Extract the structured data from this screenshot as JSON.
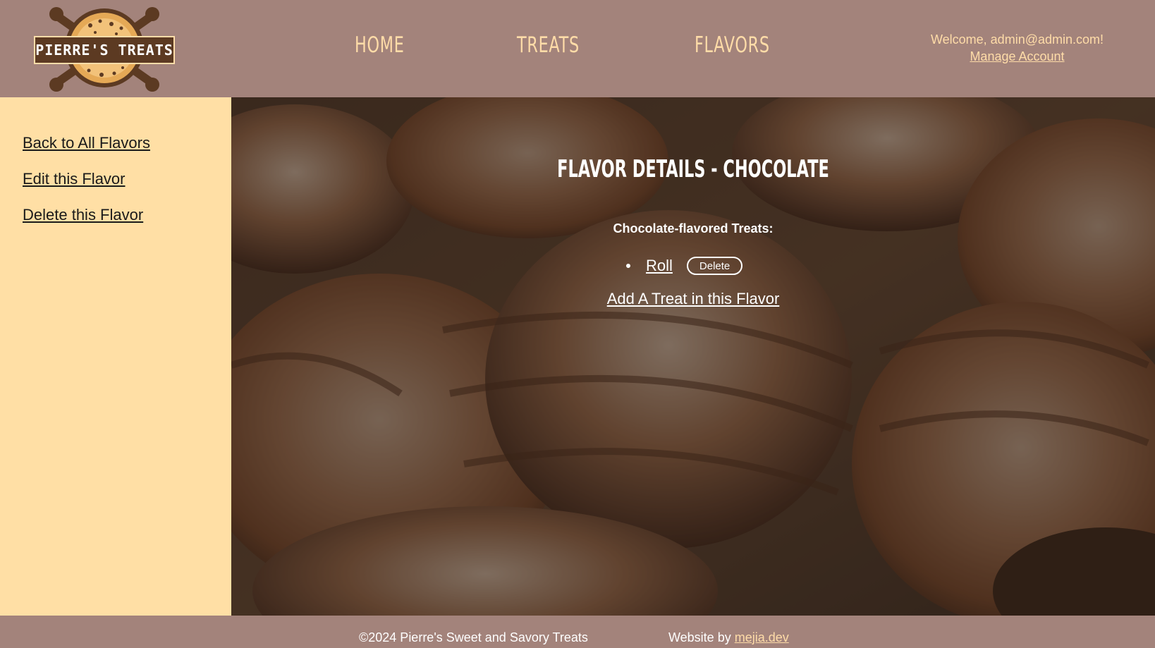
{
  "header": {
    "logo_text": "PIERRE'S TREATS",
    "nav": {
      "home": "HOME",
      "treats": "TREATS",
      "flavors": "FLAVORS"
    },
    "welcome_text": "Welcome, admin@admin.com!",
    "manage_account": "Manage Account"
  },
  "sidebar": {
    "items": [
      {
        "label": "Back to All Flavors"
      },
      {
        "label": "Edit this Flavor"
      },
      {
        "label": "Delete this Flavor"
      }
    ]
  },
  "main": {
    "title": "FLAVOR DETAILS - CHOCOLATE",
    "subheading": "Chocolate-flavored Treats:",
    "treats": [
      {
        "name": "Roll",
        "delete_label": "Delete"
      }
    ],
    "add_treat_link": "Add A Treat in this Flavor"
  },
  "footer": {
    "copyright": "©2024 Pierre's Sweet and Savory Treats",
    "credit_prefix": "Website by",
    "credit_link": "mejia.dev"
  },
  "colors": {
    "header_bg": "#a3837b",
    "accent_text": "#ffdca8",
    "sidebar_bg": "#ffdfa5",
    "logo_bg": "#5c3a22"
  },
  "icons": {
    "logo": "rolling-pins-pie-logo-icon",
    "background": "croissants-background-image"
  }
}
